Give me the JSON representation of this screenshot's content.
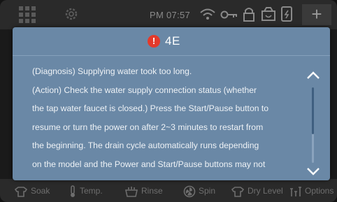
{
  "statusbar": {
    "time": "PM 07:57",
    "icons": [
      "menu-grid-icon",
      "gear-icon",
      "wifi-icon",
      "key-icon",
      "lock-icon",
      "detergent-icon",
      "phone-icon"
    ],
    "plus_label": "+"
  },
  "dialog": {
    "error_code": "4E",
    "alert_symbol": "!",
    "lines": [
      "(Diagnosis) Supplying water took too long.",
      "(Action) Check the water supply connection status (whether",
      "the tap water faucet is closed.) Press the Start/Pause button to",
      "resume or turn the power on after 2~3 minutes to restart from",
      "the beginning. The drain cycle automatically runs depending",
      "on the model and the Power and Start/Pause buttons may not"
    ],
    "scroll_position": 0.0,
    "scroll_visible_fraction": 0.62
  },
  "bottombar": {
    "items": [
      {
        "label": "Soak",
        "icon": "shirt-soak-icon"
      },
      {
        "label": "Temp.",
        "icon": "thermometer-icon"
      },
      {
        "label": "Rinse",
        "icon": "rinse-icon"
      },
      {
        "label": "Spin",
        "icon": "spin-icon"
      },
      {
        "label": "Dry Level",
        "icon": "shirt-dry-icon"
      },
      {
        "label": "Options",
        "icon": "options-icon"
      }
    ]
  },
  "colors": {
    "dialog_bg": "#6a88a6",
    "alert": "#e43a2b",
    "screen_bg": "#1a1a1a"
  }
}
